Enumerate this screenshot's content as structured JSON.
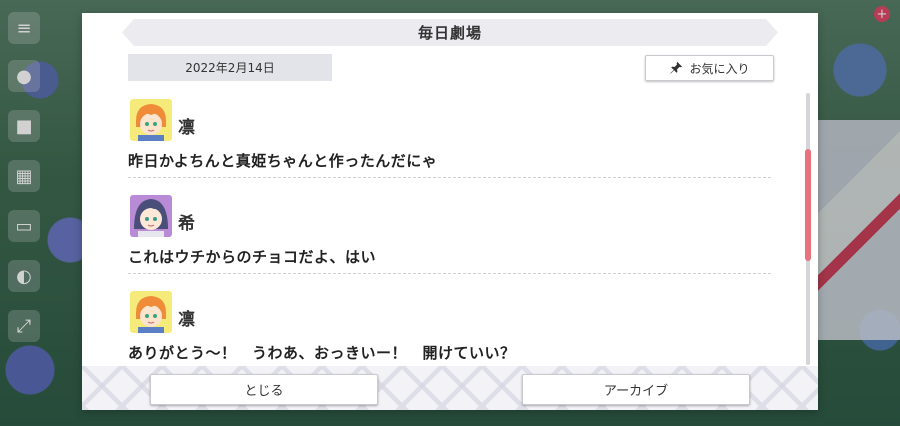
{
  "dialog": {
    "title": "毎日劇場",
    "date": "2022年2月14日",
    "favorite_label": "お気に入り",
    "close_label": "とじる",
    "archive_label": "アーカイブ"
  },
  "messages": [
    {
      "speaker": "凛",
      "text": "昨日かよちんと真姫ちゃんと作ったんだにゃ",
      "avatar": "rin"
    },
    {
      "speaker": "希",
      "text": "これはウチからのチョコだよ、はい",
      "avatar": "nozomi"
    },
    {
      "speaker": "凛",
      "text": "ありがとう～！　うわあ、おっきいー！　開けていい？",
      "avatar": "rin"
    }
  ],
  "colors": {
    "scroll_thumb": "#e8727e",
    "title_bar": "#ebebf0",
    "date_box": "#e3e3ea"
  },
  "icons": {
    "favorite": "pin-icon",
    "side_menu": [
      "menu-icon",
      "chat-icon",
      "present-icon",
      "gift-icon",
      "gallery-icon",
      "watering-can-icon",
      "fullscreen-icon"
    ]
  }
}
